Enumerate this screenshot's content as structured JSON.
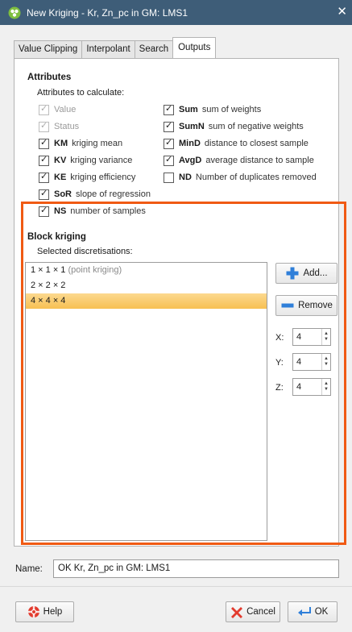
{
  "window": {
    "title": "New Kriging - Kr, Zn_pc in GM: LMS1",
    "close_glyph": "✕"
  },
  "tabs": [
    {
      "label": "Value Clipping",
      "active": false
    },
    {
      "label": "Interpolant",
      "active": false
    },
    {
      "label": "Search",
      "active": false
    },
    {
      "label": "Outputs",
      "active": true
    }
  ],
  "attributes": {
    "heading": "Attributes",
    "subheading": "Attributes to calculate:",
    "left": [
      {
        "abbr": "",
        "desc": "Value",
        "checked": true,
        "disabled": true
      },
      {
        "abbr": "",
        "desc": "Status",
        "checked": true,
        "disabled": true
      },
      {
        "abbr": "KM",
        "desc": "kriging mean",
        "checked": true,
        "disabled": false
      },
      {
        "abbr": "KV",
        "desc": "kriging variance",
        "checked": true,
        "disabled": false
      },
      {
        "abbr": "KE",
        "desc": "kriging efficiency",
        "checked": true,
        "disabled": false
      },
      {
        "abbr": "SoR",
        "desc": "slope of regression",
        "checked": true,
        "disabled": false
      },
      {
        "abbr": "NS",
        "desc": "number of samples",
        "checked": true,
        "disabled": false
      }
    ],
    "right": [
      {
        "abbr": "Sum",
        "desc": "sum of weights",
        "checked": true
      },
      {
        "abbr": "SumN",
        "desc": "sum of negative weights",
        "checked": true
      },
      {
        "abbr": "MinD",
        "desc": "distance to closest sample",
        "checked": true
      },
      {
        "abbr": "AvgD",
        "desc": "average distance to sample",
        "checked": true
      },
      {
        "abbr": "ND",
        "desc": "Number of duplicates removed",
        "checked": false
      }
    ]
  },
  "block_kriging": {
    "heading": "Block kriging",
    "subheading": "Selected discretisations:",
    "items": [
      {
        "label": "1 × 1 × 1",
        "hint": "(point kriging)",
        "selected": false
      },
      {
        "label": "2 × 2 × 2",
        "hint": "",
        "selected": false
      },
      {
        "label": "4 × 4 × 4",
        "hint": "",
        "selected": true
      }
    ],
    "add_label": "Add...",
    "remove_label": "Remove",
    "x_label": "X:",
    "x_value": "4",
    "y_label": "Y:",
    "y_value": "4",
    "z_label": "Z:",
    "z_value": "4"
  },
  "name": {
    "label": "Name:",
    "value": "OK Kr, Zn_pc in GM: LMS1"
  },
  "footer": {
    "help_label": "Help",
    "cancel_label": "Cancel",
    "ok_label": "OK"
  },
  "colors": {
    "titlebar": "#3e5d78",
    "highlight_border": "#f05a14",
    "selection": "#f7c052"
  }
}
